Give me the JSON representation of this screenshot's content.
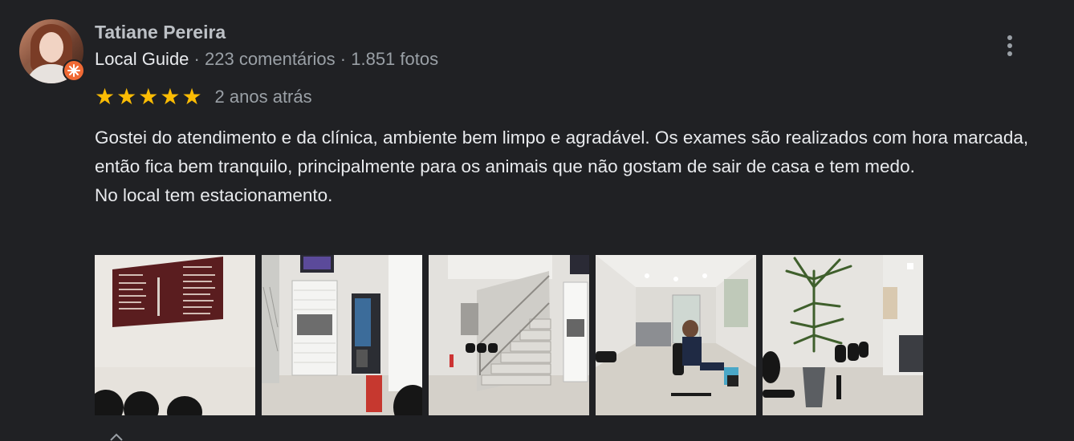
{
  "reviewer": {
    "name": "Tatiane Pereira",
    "guide_label": "Local Guide",
    "separator": "·",
    "reviews_count": "223 comentários",
    "photos_count": "1.851 fotos"
  },
  "rating": {
    "stars": 5,
    "star_glyph": "★",
    "time_ago": "2 anos atrás",
    "star_color": "#fbbc04"
  },
  "review_text": "Gostei do atendimento e da clínica, ambiente bem limpo e agradável. Os exames são realizados com hora marcada, então fica bem tranquilo, principalmente para os animais que não gostam de sair de casa e tem medo.\nNo local tem estacionamento.",
  "photos": [
    {
      "subject": "specialties-sign-photo"
    },
    {
      "subject": "reception-door-vending-photo"
    },
    {
      "subject": "stairs-photo"
    },
    {
      "subject": "waiting-room-photo"
    },
    {
      "subject": "plant-waiting-area-photo"
    }
  ],
  "colors": {
    "background": "#202124",
    "badge": "#f06a35",
    "text_primary": "#e8eaed",
    "text_secondary": "#9aa0a6"
  },
  "icons": {
    "more_options": "more-vert-icon",
    "local_guide_badge": "local-guide-badge-icon"
  }
}
